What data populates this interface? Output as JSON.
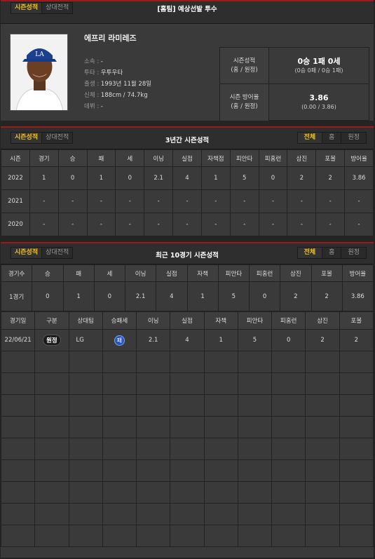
{
  "panel1": {
    "tabs": [
      "시즌성적",
      "상대전적"
    ],
    "title": "[홈팀] 예상선발 투수",
    "player_name": "에프리 라미레즈",
    "info": [
      {
        "k": "소속 :",
        "v": "-"
      },
      {
        "k": "투타 :",
        "v": "우투우타"
      },
      {
        "k": "출생 :",
        "v": "1993년 11월 28일"
      },
      {
        "k": "신체 :",
        "v": "188cm / 74.7kg"
      },
      {
        "k": "데뷔 :",
        "v": "-"
      }
    ],
    "record_label1": "시즌성적",
    "record_label2": "(홈 / 원정)",
    "record_value": "0승 1패 0세",
    "record_sub": "(0승 0패 / 0승 1패)",
    "era_label1": "시즌 방어율",
    "era_label2": "(홈 / 원정)",
    "era_value": "3.86",
    "era_sub": "(0.00 / 3.86)"
  },
  "panel2": {
    "tabs": [
      "시즌성적",
      "상대전적"
    ],
    "title": "3년간 시즌성적",
    "filters": [
      "전체",
      "홈",
      "원정"
    ],
    "headers": [
      "시즌",
      "경기",
      "승",
      "패",
      "세",
      "이닝",
      "실점",
      "자책점",
      "피안타",
      "피홈런",
      "삼진",
      "포볼",
      "방어율"
    ],
    "rows": [
      [
        "2022",
        "1",
        "0",
        "1",
        "0",
        "2.1",
        "4",
        "1",
        "5",
        "0",
        "2",
        "2",
        "3.86"
      ],
      [
        "2021",
        "-",
        "-",
        "-",
        "-",
        "-",
        "-",
        "-",
        "-",
        "-",
        "-",
        "-",
        "-"
      ],
      [
        "2020",
        "-",
        "-",
        "-",
        "-",
        "-",
        "-",
        "-",
        "-",
        "-",
        "-",
        "-",
        "-"
      ]
    ]
  },
  "panel3": {
    "tabs": [
      "시즌성적",
      "상대전적"
    ],
    "title": "최근 10경기 시즌성적",
    "filters": [
      "전체",
      "홈",
      "원정"
    ],
    "summary_headers": [
      "경기수",
      "승",
      "패",
      "세",
      "이닝",
      "실점",
      "자책",
      "피안타",
      "피홈런",
      "삼진",
      "포볼",
      "방어율"
    ],
    "summary_row": [
      "1경기",
      "0",
      "1",
      "0",
      "2.1",
      "4",
      "1",
      "5",
      "0",
      "2",
      "2",
      "3.86"
    ],
    "game_headers": [
      "경기일",
      "구분",
      "상대팀",
      "승패세",
      "이닝",
      "실점",
      "자책",
      "피안타",
      "피홈런",
      "삼진",
      "포볼"
    ],
    "games": [
      [
        "22/06/21",
        "원정",
        "LG",
        "패",
        "2.1",
        "4",
        "1",
        "5",
        "0",
        "2",
        "2"
      ]
    ]
  },
  "colors": {
    "accent": "#f3c31a",
    "border_red": "#a01818",
    "loss_badge": "#2d55b8"
  }
}
